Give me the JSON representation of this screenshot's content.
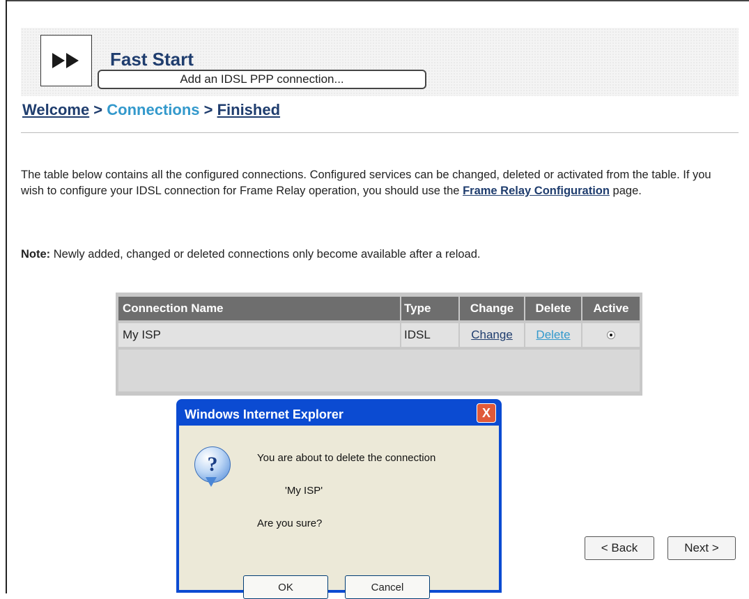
{
  "header": {
    "title": "Fast Start",
    "logo_icon": "fast-forward-icon"
  },
  "breadcrumb": {
    "welcome": "Welcome",
    "sep1": " > ",
    "connections": "Connections",
    "sep2": " > ",
    "finished": "Finished"
  },
  "intro": {
    "text_before": "The table below contains all the configured connections. Configured services can be changed, deleted or activated from the table. If you wish to configure your IDSL connection for Frame Relay operation, you should use the ",
    "link": "Frame Relay Configuration",
    "text_after": " page."
  },
  "note": {
    "label": "Note:",
    "text": " Newly added, changed or deleted connections only become available after a reload."
  },
  "table": {
    "headers": [
      "Connection Name",
      "Type",
      "Change",
      "Delete",
      "Active"
    ],
    "rows": [
      {
        "name": "My ISP",
        "type": "IDSL",
        "change": "Change",
        "delete": "Delete",
        "active": true
      }
    ],
    "add_button": "Add an IDSL PPP connection..."
  },
  "nav": {
    "back": "< Back",
    "next": "Next >"
  },
  "dialog": {
    "title": "Windows Internet Explorer",
    "close": "X",
    "icon": "question-icon",
    "line1": "You are about to delete the connection",
    "line2": "'My ISP'",
    "line3": "Are you sure?",
    "ok": "OK",
    "cancel": "Cancel"
  },
  "colors": {
    "banner_title": "#1f3d6e",
    "current_step": "#3399cc",
    "dialog_titlebar": "#0b4bd2",
    "table_header": "#6e6e6e"
  }
}
